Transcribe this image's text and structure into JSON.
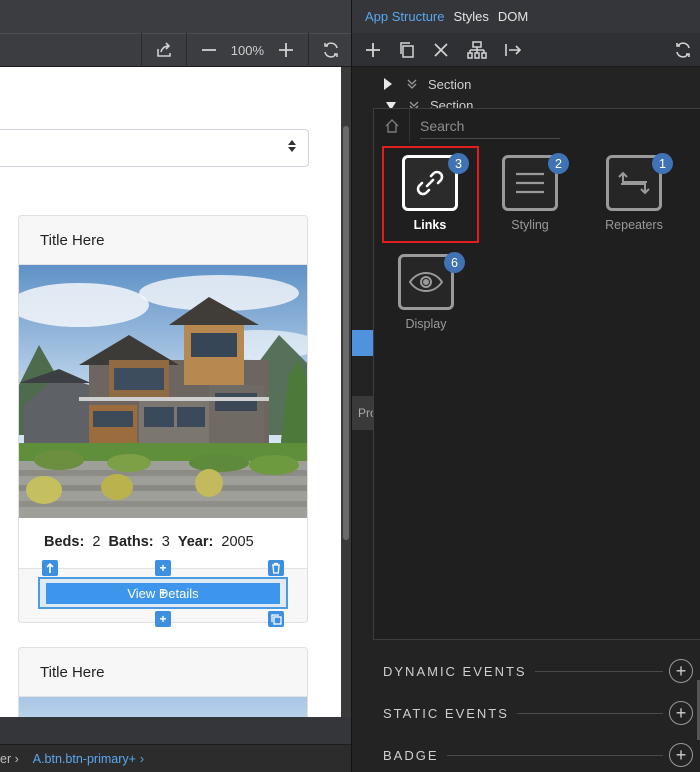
{
  "left": {
    "zoom": "100%",
    "select_arrows": "▲▼",
    "cards": [
      {
        "title": "Title Here",
        "beds_label": "Beds:",
        "beds": "2",
        "baths_label": "Baths:",
        "baths": "3",
        "year_label": "Year:",
        "year": "2005",
        "button_label": "View Details"
      },
      {
        "title": "Title Here"
      }
    ],
    "handles": {
      "up": "⤒",
      "plus": "+",
      "trash": "🗑",
      "copy": "❐"
    },
    "breadcrumb": {
      "prefix": "er ›",
      "current": "A.btn.btn-primary+",
      "suffix": "›"
    }
  },
  "right": {
    "tabs": [
      "App Structure",
      "Styles",
      "DOM"
    ],
    "active_tab": "App Structure",
    "tree": [
      {
        "label": "Section",
        "expanded": false
      },
      {
        "label": "Section",
        "expanded": true
      }
    ],
    "side_text": "Pro",
    "search": {
      "placeholder": "Search"
    },
    "categories": [
      {
        "label": "Links",
        "count": "3",
        "icon": "link-icon",
        "selected": true
      },
      {
        "label": "Styling",
        "count": "2",
        "icon": "menu-lines-icon",
        "selected": false
      },
      {
        "label": "Repeaters",
        "count": "1",
        "icon": "repeat-icon",
        "selected": false
      },
      {
        "label": "Display",
        "count": "6",
        "icon": "eye-icon",
        "selected": false
      }
    ],
    "sections": [
      "DYNAMIC EVENTS",
      "STATIC EVENTS",
      "BADGE"
    ]
  },
  "colors": {
    "accent": "#5aa7ef",
    "highlight": "#e11e1e",
    "badge": "#3f73b6",
    "selection": "#3e96ec"
  }
}
